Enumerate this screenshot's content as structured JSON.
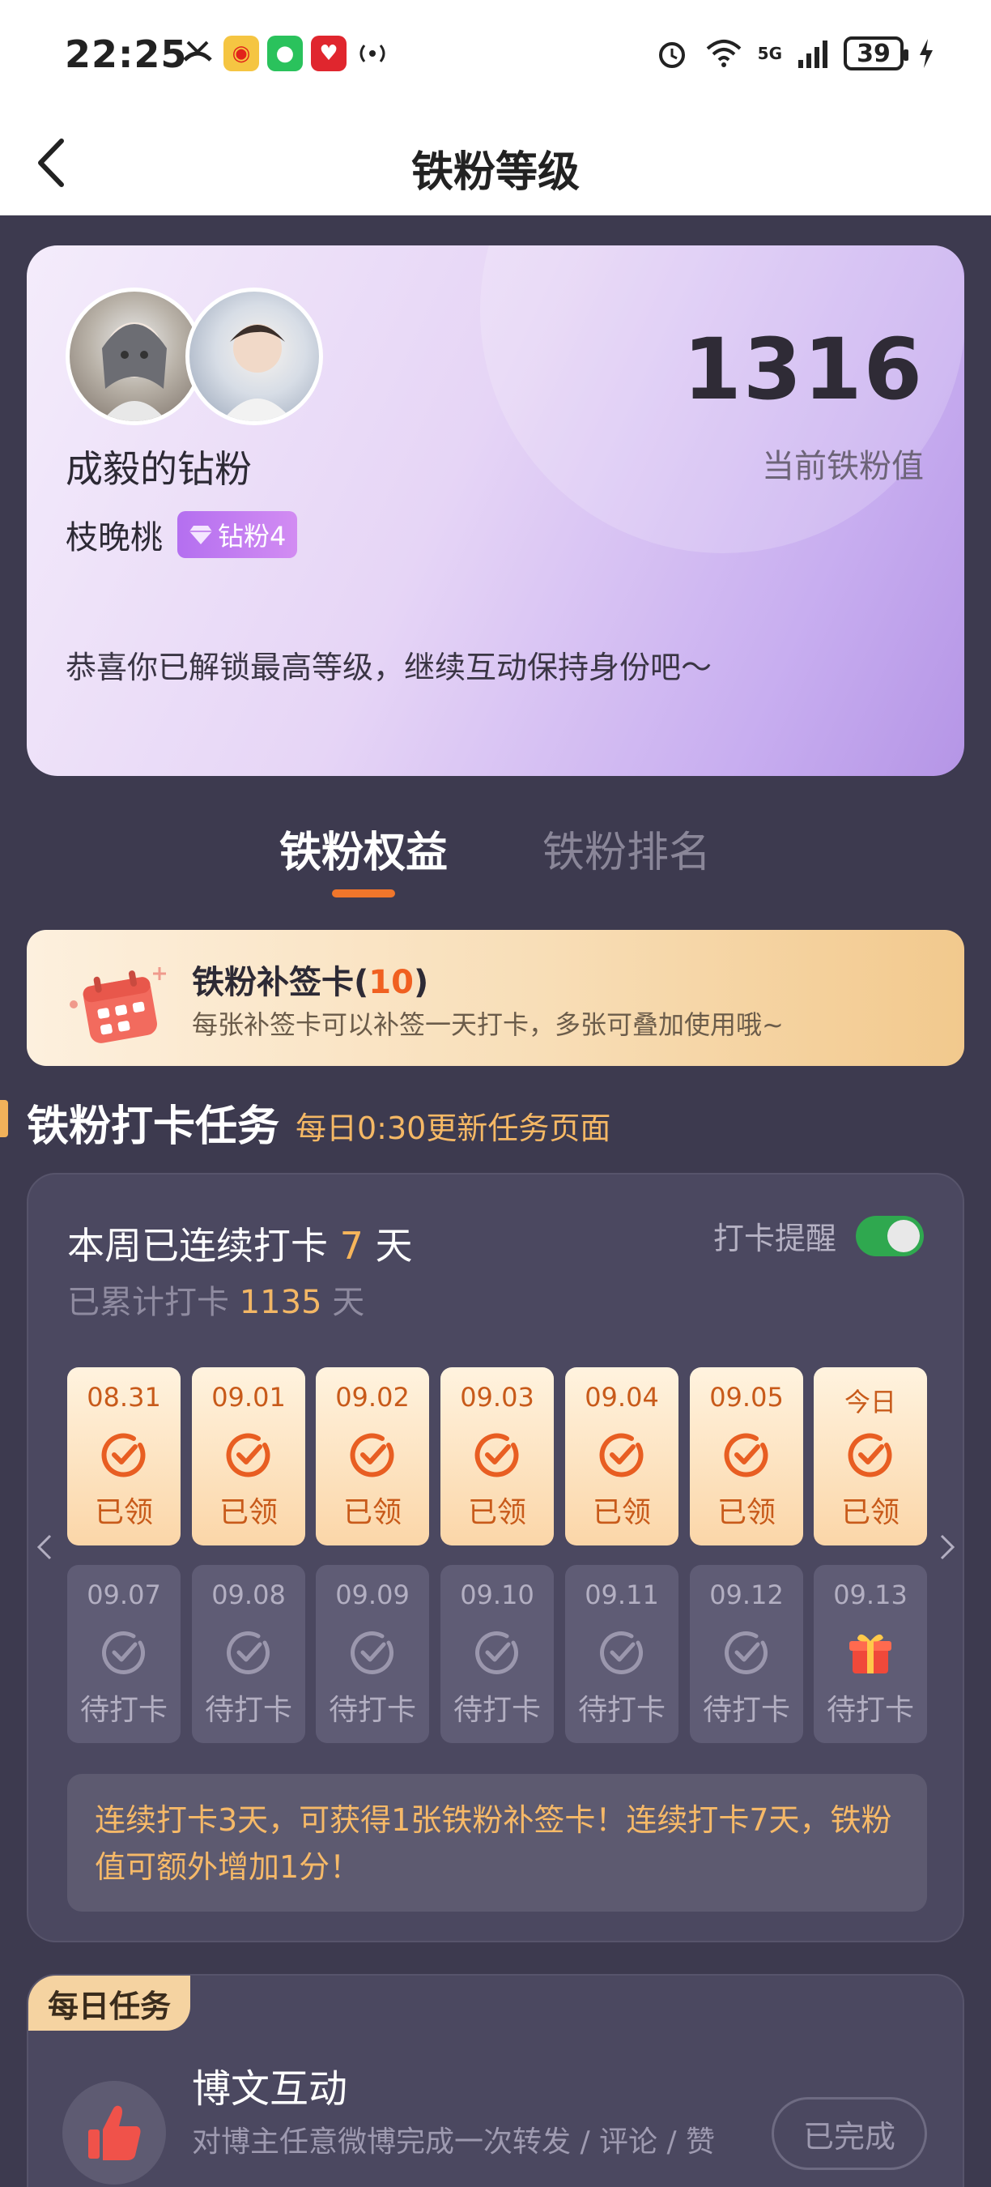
{
  "status_bar": {
    "time": "22:25",
    "network": "5G",
    "battery": "39"
  },
  "nav": {
    "title": "铁粉等级"
  },
  "profile": {
    "fan_title": "成毅的钻粉",
    "username": "枝晚桃",
    "level_badge": "钻粉4",
    "score": "1316",
    "score_label": "当前铁粉值",
    "message": "恭喜你已解锁最高等级，继续互动保持身份吧～"
  },
  "tabs": [
    {
      "label": "铁粉权益",
      "active": true
    },
    {
      "label": "铁粉排名",
      "active": false
    }
  ],
  "supplement": {
    "title": "铁粉补签卡",
    "count": "10",
    "description": "每张补签卡可以补签一天打卡，多张可叠加使用哦~"
  },
  "checkin_section": {
    "title": "铁粉打卡任务",
    "note": "每日0:30更新任务页面"
  },
  "checkin": {
    "streak_prefix": "本周已连续打卡 ",
    "streak_days": "7",
    "streak_suffix": " 天",
    "total_prefix": "已累计打卡 ",
    "total_days": "1135",
    "total_suffix": " 天",
    "remind_label": "打卡提醒",
    "remind_on": true,
    "week_claimed": [
      {
        "date": "08.31",
        "status": "已领"
      },
      {
        "date": "09.01",
        "status": "已领"
      },
      {
        "date": "09.02",
        "status": "已领"
      },
      {
        "date": "09.03",
        "status": "已领"
      },
      {
        "date": "09.04",
        "status": "已领"
      },
      {
        "date": "09.05",
        "status": "已领"
      },
      {
        "date": "今日",
        "status": "已领"
      }
    ],
    "week_pending": [
      {
        "date": "09.07",
        "status": "待打卡",
        "icon": "check-circle-icon"
      },
      {
        "date": "09.08",
        "status": "待打卡",
        "icon": "check-circle-icon"
      },
      {
        "date": "09.09",
        "status": "待打卡",
        "icon": "check-circle-icon"
      },
      {
        "date": "09.10",
        "status": "待打卡",
        "icon": "check-circle-icon"
      },
      {
        "date": "09.11",
        "status": "待打卡",
        "icon": "check-circle-icon"
      },
      {
        "date": "09.12",
        "status": "待打卡",
        "icon": "check-circle-icon"
      },
      {
        "date": "09.13",
        "status": "待打卡",
        "icon": "gift-icon"
      }
    ],
    "tip": "连续打卡3天，可获得1张铁粉补签卡！连续打卡7天，铁粉值可额外增加1分！"
  },
  "daily_tasks": {
    "tag": "每日任务",
    "task_title": "博文互动",
    "task_desc": "对博主任意微博完成一次转发 / 评论 / 赞",
    "button": "已完成"
  },
  "colors": {
    "page_bg": "#3d3a4f",
    "accent_orange": "#f0762b",
    "highlight_gold": "#f7b55a",
    "toggle_green": "#2fa84f"
  }
}
